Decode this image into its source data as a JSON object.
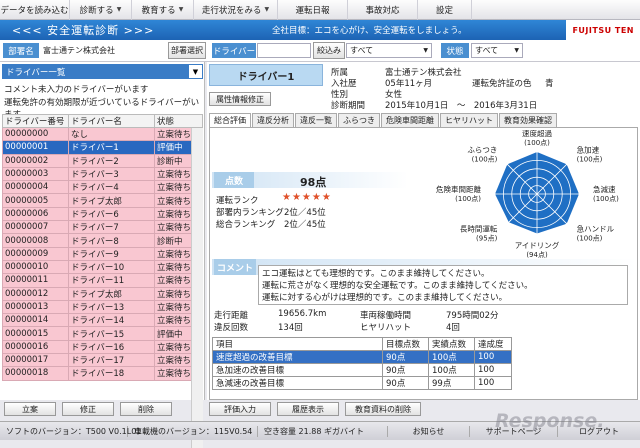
{
  "menu": [
    {
      "label": "データを読み込む",
      "dropdown": false
    },
    {
      "label": "診断する",
      "dropdown": true
    },
    {
      "label": "教育する",
      "dropdown": true
    },
    {
      "label": "走行状況をみる",
      "dropdown": true
    },
    {
      "label": "運転日報",
      "dropdown": false
    },
    {
      "label": "事故対応",
      "dropdown": false
    },
    {
      "label": "設定",
      "dropdown": false
    }
  ],
  "title": {
    "app": "<<< 安全運転診断 >>>",
    "slogan": "全社目標：エコを心がけ、安全運転をしましょう。",
    "logo": "FUJITSU TEN"
  },
  "filter": {
    "dept_label": "部署名",
    "dept_value": "富士通テン株式会社",
    "dept_btn": "部署選択",
    "driver_label": "ドライバー",
    "driver_value": "",
    "narrow_btn": "絞込み",
    "narrow_value": "すべて",
    "status_label": "状態",
    "status_value": "すべて"
  },
  "left": {
    "list_select": "ドライバー一覧",
    "notice1": "コメント未入力のドライバーがいます",
    "notice2": "運転免許の有効期限が近づいているドライバーがいます",
    "headers": [
      "ドライバー番号",
      "ドライバー名",
      "状態"
    ],
    "rows": [
      {
        "no": "00000000",
        "name": "なし",
        "status": "立案待ち"
      },
      {
        "no": "00000001",
        "name": "ドライバー1",
        "status": "評価中"
      },
      {
        "no": "00000002",
        "name": "ドライバー2",
        "status": "診断中"
      },
      {
        "no": "00000003",
        "name": "ドライバー3",
        "status": "立案待ち"
      },
      {
        "no": "00000004",
        "name": "ドライバー4",
        "status": "立案待ち"
      },
      {
        "no": "00000005",
        "name": "ドライブ太郎",
        "status": "立案待ち"
      },
      {
        "no": "00000006",
        "name": "ドライバー6",
        "status": "立案待ち"
      },
      {
        "no": "00000007",
        "name": "ドライバー7",
        "status": "立案待ち"
      },
      {
        "no": "00000008",
        "name": "ドライバー8",
        "status": "診断中"
      },
      {
        "no": "00000009",
        "name": "ドライバー9",
        "status": "立案待ち"
      },
      {
        "no": "00000010",
        "name": "ドライバー10",
        "status": "立案待ち"
      },
      {
        "no": "00000011",
        "name": "ドライバー11",
        "status": "立案待ち"
      },
      {
        "no": "00000012",
        "name": "ドライブ太郎",
        "status": "立案待ち"
      },
      {
        "no": "00000013",
        "name": "ドライバー13",
        "status": "立案待ち"
      },
      {
        "no": "00000014",
        "name": "ドライバー14",
        "status": "立案待ち"
      },
      {
        "no": "00000015",
        "name": "ドライバー15",
        "status": "評価中"
      },
      {
        "no": "00000016",
        "name": "ドライバー16",
        "status": "立案待ち"
      },
      {
        "no": "00000017",
        "name": "ドライバー17",
        "status": "立案待ち"
      },
      {
        "no": "00000018",
        "name": "ドライバー18",
        "status": "立案待ち"
      }
    ],
    "selected_index": 1,
    "buttons": [
      "立案",
      "修正",
      "削除"
    ]
  },
  "driver": {
    "name": "ドライバー1",
    "attr_btn": "属性情報修正",
    "fields": [
      {
        "label": "所属",
        "value": "富士通テン株式会社"
      },
      {
        "label": "入社歴",
        "value": "05年11ヶ月"
      },
      {
        "label": "性別",
        "value": "女性"
      },
      {
        "label": "診断期間",
        "value": "2015年10月1日　～　2016年3月31日"
      }
    ],
    "license_label": "運転免許証の色",
    "license_value": "青"
  },
  "tabs": [
    "総合評価",
    "違反分析",
    "違反一覧",
    "ふらつき",
    "危険車間距離",
    "ヒヤリハット",
    "教育効果確認"
  ],
  "active_tab": 0,
  "score": {
    "label": "点数",
    "value": "98点",
    "rank_label": "運転ランク",
    "stars": "★★★★★",
    "dept_rank_label": "部署内ランキング",
    "dept_rank": "2位／45位",
    "total_rank_label": "総合ランキング",
    "total_rank": "2位／45位"
  },
  "chart_data": {
    "type": "radar",
    "axes": [
      {
        "name": "速度超過",
        "value": 100,
        "display": "(100点)"
      },
      {
        "name": "急加速",
        "value": 100,
        "display": "(100点)"
      },
      {
        "name": "急減速",
        "value": 100,
        "display": "(100点)"
      },
      {
        "name": "急ハンドル",
        "value": 100,
        "display": "(100点)"
      },
      {
        "name": "アイドリング",
        "value": 94,
        "display": "(94点)"
      },
      {
        "name": "長時間運転",
        "value": 95,
        "display": "(95点)"
      },
      {
        "name": "危険車間距離",
        "value": 100,
        "display": "(100点)"
      },
      {
        "name": "ふらつき",
        "value": 100,
        "display": "(100点)"
      }
    ],
    "range": [
      0,
      100
    ],
    "rings": 5,
    "fill_color": "#1f6fc4",
    "grid_color": "#ffffff"
  },
  "comment": {
    "label": "コメント",
    "lines": [
      "エコ運転はとても理想的です。このまま維持してください。",
      "運転に荒さがなく理想的な安全運転です。このまま維持してください。",
      "運転に対する心がけは理想的です。このまま維持してください。"
    ]
  },
  "stats": [
    {
      "label": "走行距離",
      "value": "19656.7km",
      "label2": "車両稼働時間",
      "value2": "795時間02分"
    },
    {
      "label": "違反回数",
      "value": "134回",
      "label2": "ヒヤリハット",
      "value2": "4回"
    }
  ],
  "goals": {
    "headers": [
      "項目",
      "目標点数",
      "実績点数",
      "達成度"
    ],
    "rows": [
      {
        "item": "速度超過の改善目標",
        "target": "90点",
        "actual": "100点",
        "rate": "100"
      },
      {
        "item": "急加速の改善目標",
        "target": "90点",
        "actual": "100点",
        "rate": "100"
      },
      {
        "item": "急減速の改善目標",
        "target": "90点",
        "actual": "99点",
        "rate": "100"
      }
    ],
    "highlight_index": 0
  },
  "right_buttons": [
    "評価入力",
    "履歴表示",
    "教育資料の削除"
  ],
  "statusbar": {
    "software": "ソフトのバージョン：T500 V0.1L01",
    "vehicle": "車載機のバージョン：115V0.54",
    "space": "空き容量 21.88 ギガバイト",
    "notice": "お知らせ",
    "support": "サポートページ",
    "logout": "ログアウト"
  },
  "watermark": "Response."
}
